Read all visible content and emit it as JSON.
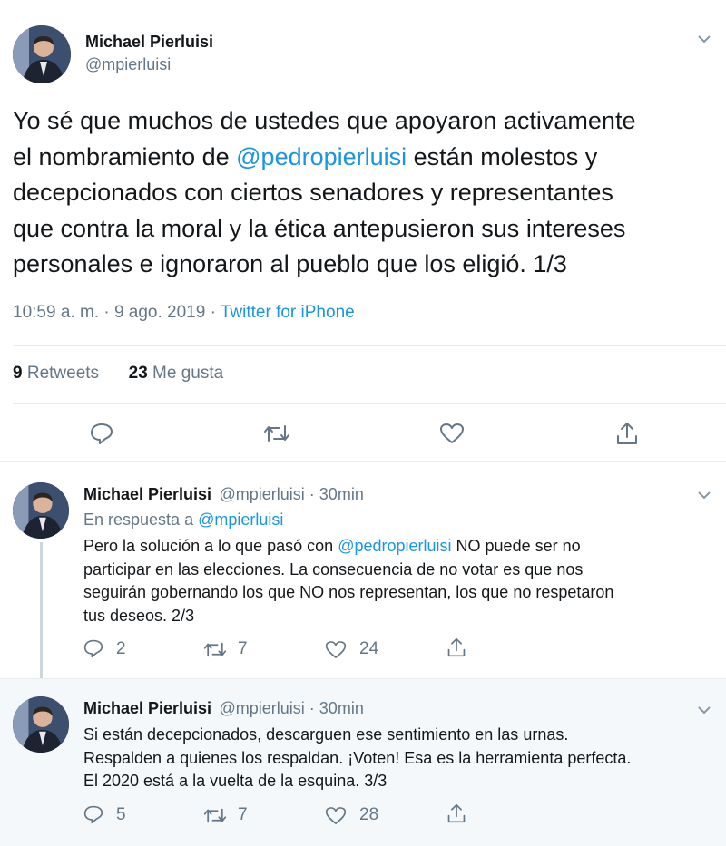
{
  "main": {
    "name": "Michael Pierluisi",
    "handle": "@mpierluisi",
    "text_1": "Yo sé que muchos de ustedes que apoyaron activamente",
    "text_2a": "el nombramiento de ",
    "mention": "@pedropierluisi",
    "text_2b": " están molestos y",
    "text_3": "decepcionados con ciertos senadores y representantes",
    "text_4": "que contra la moral y la ética antepusieron sus intereses",
    "text_5": "personales e ignoraron al pueblo que los eligió. 1/3",
    "time": "10:59 a. m. · 9 ago. 2019 · ",
    "source": "Twitter for iPhone",
    "retweets": "9",
    "retweets_label": " Retweets",
    "likes": "23",
    "likes_label": " Me gusta"
  },
  "reply1": {
    "name": "Michael Pierluisi",
    "handle": "@mpierluisi · 30min",
    "reply_prefix": "En respuesta a ",
    "reply_to": "@mpierluisi",
    "line1a": "Pero la solución a lo que pasó con ",
    "line1_mention": "@pedropierluisi",
    "line1b": " NO puede ser no",
    "line2": "participar en las elecciones. La consecuencia de no votar es que nos",
    "line3": "seguirán gobernando los que NO nos representan, los que no respetaron",
    "line4": "tus deseos. 2/3",
    "replies": "2",
    "retweets": "7",
    "likes": "24"
  },
  "reply2": {
    "name": "Michael Pierluisi",
    "handle": "@mpierluisi · 30min",
    "line1": "Si están decepcionados, descarguen ese sentimiento en las urnas.",
    "line2": "Respalden a quienes los respaldan. ¡Voten! Esa es la herramienta perfecta.",
    "line3": "El 2020 está a la vuelta de la esquina. 3/3",
    "replies": "5",
    "retweets": "7",
    "likes": "28"
  }
}
